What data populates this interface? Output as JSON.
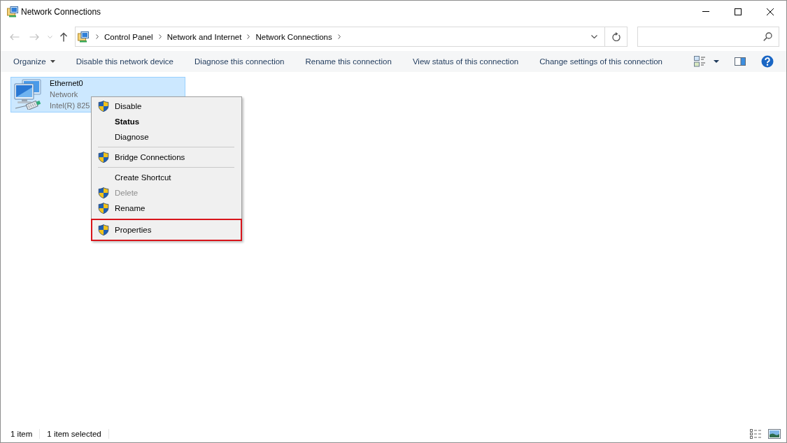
{
  "window": {
    "title": "Network Connections"
  },
  "navigation": {
    "back": {
      "disabled": true
    },
    "forward": {
      "disabled": true
    },
    "up": {
      "disabled": false
    }
  },
  "address_bar": {
    "path": [
      "Control Panel",
      "Network and Internet",
      "Network Connections"
    ]
  },
  "command_bar": {
    "items": [
      {
        "label": "Organize",
        "has_menu": true
      },
      {
        "label": "Disable this network device",
        "has_menu": false
      },
      {
        "label": "Diagnose this connection",
        "has_menu": false
      },
      {
        "label": "Rename this connection",
        "has_menu": false
      },
      {
        "label": "View status of this connection",
        "has_menu": false
      },
      {
        "label": "Change settings of this connection",
        "has_menu": false
      }
    ]
  },
  "connections": [
    {
      "name": "Ethernet0",
      "status": "Network",
      "device": "Intel(R) 825",
      "selected": true
    }
  ],
  "context_menu": {
    "items": [
      {
        "kind": "item",
        "label": "Disable",
        "shield": true,
        "bold": false,
        "disabled": false,
        "highlighted": false
      },
      {
        "kind": "item",
        "label": "Status",
        "shield": false,
        "bold": true,
        "disabled": false,
        "highlighted": false
      },
      {
        "kind": "item",
        "label": "Diagnose",
        "shield": false,
        "bold": false,
        "disabled": false,
        "highlighted": false
      },
      {
        "kind": "separator"
      },
      {
        "kind": "item",
        "label": "Bridge Connections",
        "shield": true,
        "bold": false,
        "disabled": false,
        "highlighted": false
      },
      {
        "kind": "separator"
      },
      {
        "kind": "item",
        "label": "Create Shortcut",
        "shield": false,
        "bold": false,
        "disabled": false,
        "highlighted": false
      },
      {
        "kind": "item",
        "label": "Delete",
        "shield": true,
        "bold": false,
        "disabled": true,
        "highlighted": false
      },
      {
        "kind": "item",
        "label": "Rename",
        "shield": true,
        "bold": false,
        "disabled": false,
        "highlighted": false
      },
      {
        "kind": "item",
        "label": "Properties",
        "shield": true,
        "bold": false,
        "disabled": false,
        "highlighted": true
      }
    ]
  },
  "status_bar": {
    "item_count": "1 item",
    "selection": "1 item selected"
  }
}
